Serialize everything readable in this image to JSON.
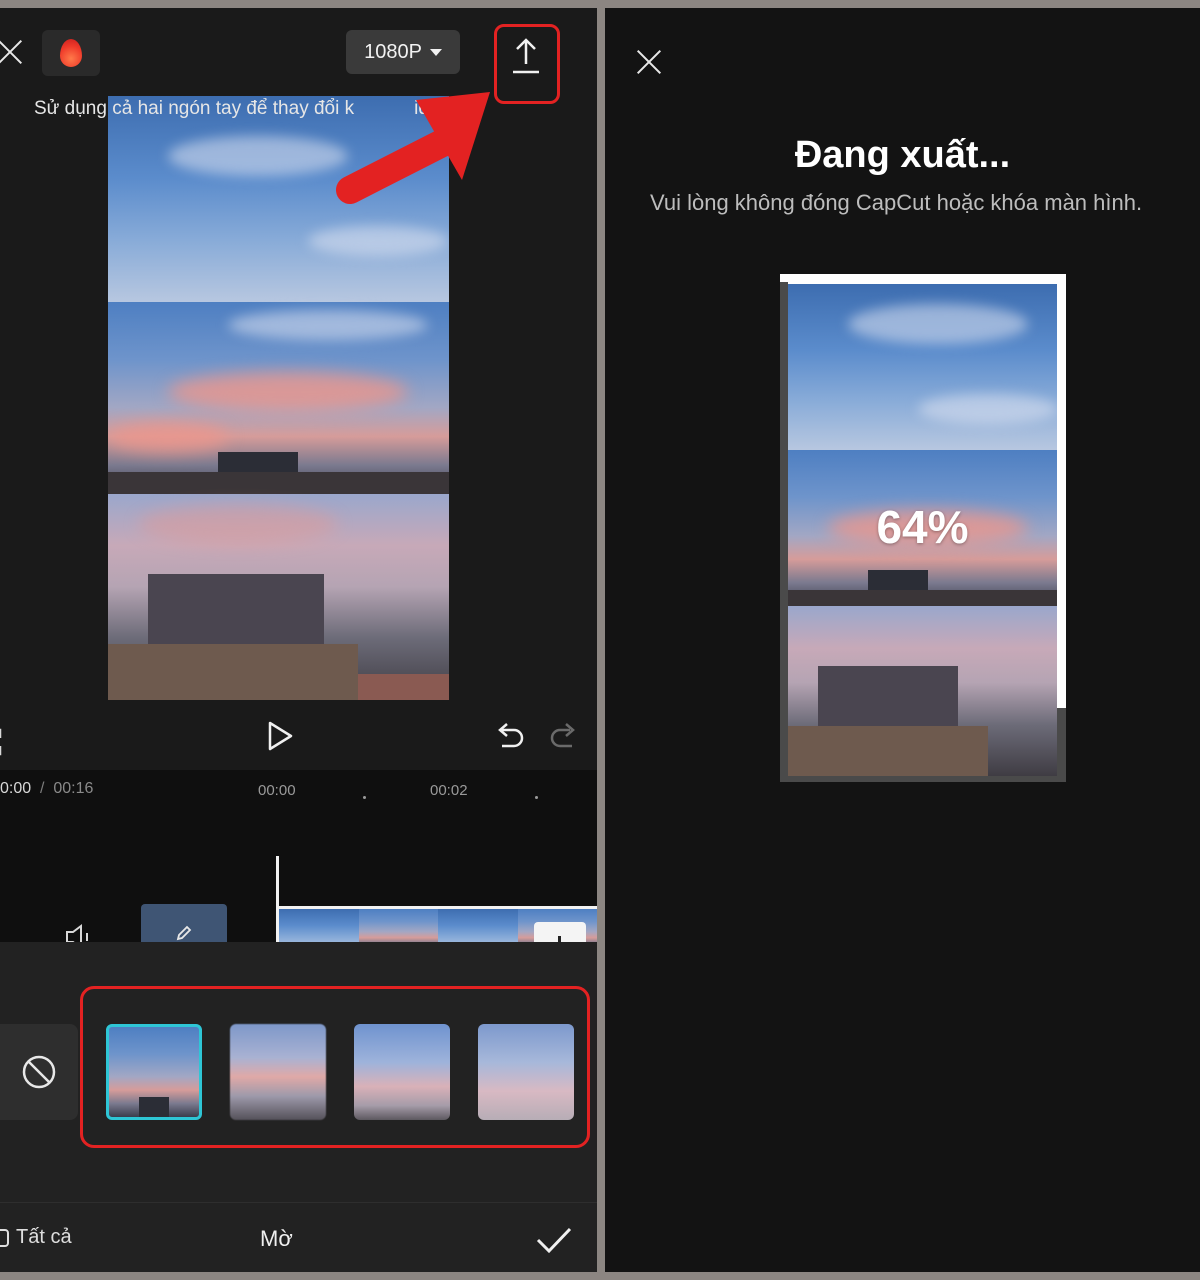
{
  "left": {
    "resolution": "1080P",
    "hint": "Sử dụng cả hai ngón tay để thay đổi k",
    "hint_tail": "ideo",
    "time_current": "0:00",
    "time_sep": "/",
    "time_total": "00:16",
    "ticks": [
      "00:00",
      "00:02"
    ],
    "bottom_bar": {
      "all_label": "Tất cả",
      "title": "Mờ"
    }
  },
  "right": {
    "title": "Đang xuất...",
    "subtitle": "Vui lòng không đóng CapCut hoặc khóa màn hình.",
    "progress": "64%"
  },
  "colors": {
    "highlight_red": "#e32222",
    "selected_cyan": "#2ec6d6",
    "flame": "#ef3a2a"
  },
  "icons": [
    "close-icon",
    "flame-icon",
    "caret-down-icon",
    "export-upload-icon",
    "fullscreen-icon",
    "play-icon",
    "undo-icon",
    "redo-icon",
    "volume-icon",
    "edit-pencil-icon",
    "add-icon",
    "none-icon",
    "all-icon",
    "checkmark-icon"
  ]
}
